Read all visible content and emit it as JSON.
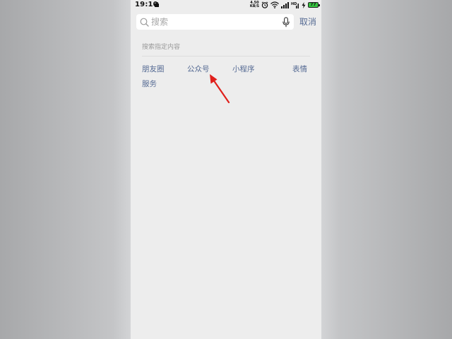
{
  "status_bar": {
    "time": "19:10",
    "net_speed_top": "4.50",
    "net_speed_bottom": "KB/S",
    "battery_level": "77",
    "icons": [
      "notification-icon",
      "alarm-icon",
      "wifi-icon",
      "signal-icon",
      "hd-signal-icon",
      "charging-icon",
      "battery-icon"
    ]
  },
  "search": {
    "placeholder": "搜索",
    "value": "",
    "cancel_label": "取消",
    "search_icon": "search-icon",
    "mic_icon": "mic-icon"
  },
  "content": {
    "section_title": "搜索指定内容",
    "categories": [
      {
        "label": "朋友圈"
      },
      {
        "label": "公众号"
      },
      {
        "label": "小程序"
      },
      {
        "label": "表情"
      },
      {
        "label": "服务"
      }
    ]
  },
  "colors": {
    "link": "#566b94",
    "background": "#ededed",
    "annotation_arrow": "#e0201c"
  },
  "annotation": {
    "type": "arrow",
    "points_to": "公众号"
  }
}
